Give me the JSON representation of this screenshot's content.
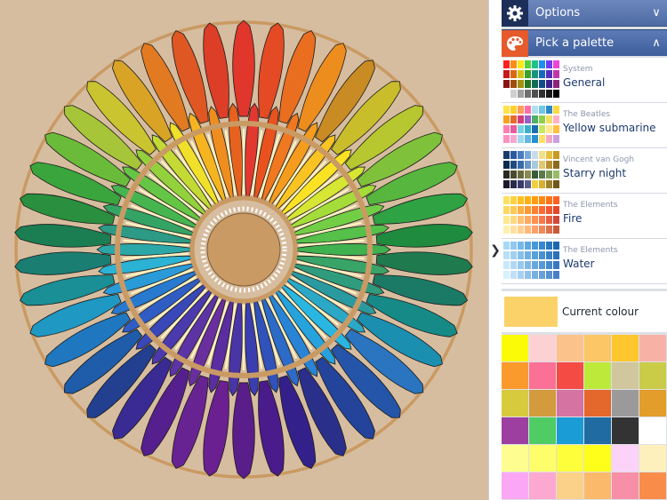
{
  "sidebar": {
    "options_label": "Options",
    "palette_label": "Pick a palette",
    "palettes": [
      {
        "category": "System",
        "name": "General",
        "swatches": [
          "#ff1f1f",
          "#ff8c1a",
          "#ffe817",
          "#55d13a",
          "#1fbf8e",
          "#1e8ff0",
          "#6a3df0",
          "#ee45d9",
          "#c51a1a",
          "#d96a12",
          "#d6c214",
          "#3aa12a",
          "#18957a",
          "#1769bd",
          "#532fbd",
          "#c036a9",
          "#8a1414",
          "#a04e0f",
          "#a1910f",
          "#2a7520",
          "#116b57",
          "#104c8a",
          "#3c228a",
          "#8a277a",
          "#ffffff",
          "#d0d0d0",
          "#a0a0a0",
          "#707070",
          "#505050",
          "#303030",
          "#181818",
          "#000000"
        ]
      },
      {
        "category": "The Beatles",
        "name": "Yellow submarine",
        "swatches": [
          "#ffe24a",
          "#ffd02a",
          "#ff9e5a",
          "#ff6fa8",
          "#b0e0f0",
          "#6fc7e8",
          "#2e89c8",
          "#ffd93d",
          "#f7a21c",
          "#e86a2a",
          "#d23d7a",
          "#9a5fc8",
          "#4fb06a",
          "#8fd04a",
          "#f0e060",
          "#ffb0c8",
          "#ff80b0",
          "#e85aa0",
          "#7ad0e0",
          "#3ab0d0",
          "#1a70b0",
          "#c8e860",
          "#ffe890",
          "#ffc040",
          "#ff90c0",
          "#f6a8d0",
          "#a0d8f0",
          "#60b8e8",
          "#2890d0",
          "#ffe060",
          "#f0a8c8",
          "#c8a0e0"
        ]
      },
      {
        "category": "Vincent van Gogh",
        "name": "Starry night",
        "swatches": [
          "#1a3a6e",
          "#2a5a9e",
          "#4a7ac0",
          "#7aa8d8",
          "#c8dcec",
          "#f0e08a",
          "#e8c040",
          "#c89a20",
          "#0e2a50",
          "#1e4a80",
          "#3a6aa8",
          "#6a98c8",
          "#a8c8e0",
          "#e0c870",
          "#b89030",
          "#8a6a20",
          "#2a2a20",
          "#4a4a30",
          "#6a6a40",
          "#8a8a50",
          "#3a5a3a",
          "#5a7a4a",
          "#7a9a5a",
          "#9aba6a",
          "#1a1a2a",
          "#2a2a4a",
          "#3a3a6a",
          "#5a5a8a",
          "#f0d040",
          "#d8b030",
          "#a08028",
          "#705818"
        ]
      },
      {
        "category": "The Elements",
        "name": "Fire",
        "swatches": [
          "#ffe060",
          "#ffd040",
          "#ffc020",
          "#ffb010",
          "#ff9c10",
          "#ff8810",
          "#ff7418",
          "#ff6020",
          "#ffd860",
          "#ffc850",
          "#ffb040",
          "#ff9830",
          "#ff8030",
          "#ff6a30",
          "#f05a30",
          "#e04a28",
          "#ffe890",
          "#ffd880",
          "#ffc070",
          "#ffa860",
          "#ff9050",
          "#f87848",
          "#e86040",
          "#d04838",
          "#fff0b0",
          "#ffe0a0",
          "#ffd090",
          "#ffb878",
          "#ffa068",
          "#f08858",
          "#e07048",
          "#c85838"
        ]
      },
      {
        "category": "The Elements",
        "name": "Water",
        "swatches": [
          "#a8d8f8",
          "#90c8f0",
          "#78b8e8",
          "#60a8e0",
          "#4898d8",
          "#3888d0",
          "#2878c0",
          "#1868b0",
          "#b8e0f8",
          "#a0d0f0",
          "#88c0e8",
          "#70b0e0",
          "#58a0d8",
          "#4890d0",
          "#3880c8",
          "#2870b8",
          "#c8e8fc",
          "#b0d8f4",
          "#98c8ec",
          "#80b8e4",
          "#68a8dc",
          "#5898d4",
          "#4888cc",
          "#3878c0",
          "#d8f0ff",
          "#c0e0f8",
          "#a8d0f0",
          "#90c0e8",
          "#78b0e0",
          "#68a0d8",
          "#5890d0",
          "#4880c8"
        ]
      }
    ],
    "current_colour_label": "Current colour",
    "current_colour": "#fbd26a",
    "swatch_grid": [
      [
        "#fbfb08",
        "#fdd1d3",
        "#fcc28b",
        "#fcc565",
        "#fdc72d",
        "#f7b2a5"
      ],
      [
        "#fb9a2c",
        "#fb7196",
        "#f54b45",
        "#bde93a",
        "#d0c79f",
        "#c9cb49"
      ],
      [
        "#d7ca3d",
        "#d39b3d",
        "#d573a3",
        "#e4672b",
        "#9a9a9a",
        "#e39d2b"
      ],
      [
        "#9c3fa1",
        "#4fcc64",
        "#1a9cd7",
        "#1f6ba2",
        "#333333",
        "#ffffff"
      ],
      [
        "#fefe90",
        "#fefe6a",
        "#fefe3a",
        "#fefe1a",
        "#fbd3f9",
        "#fef0bc"
      ],
      [
        "#fca7f3",
        "#fca8d0",
        "#fbd088",
        "#fbb96c",
        "#f78fa8",
        "#fa8c4a"
      ]
    ]
  },
  "artwork": {
    "background": "#d7bd9f",
    "ring_color": "#c99a63",
    "outer_feather_colors": [
      "#e0362b",
      "#e44a23",
      "#ea6e1f",
      "#ed8d1e",
      "#c98b23",
      "#c9bd2b",
      "#b6c72f",
      "#7fc13a",
      "#56b63e",
      "#2fa243",
      "#1f8b3e",
      "#1f7b4e",
      "#1b7a65",
      "#158a87",
      "#1b8faf",
      "#2a74c0",
      "#2555a8",
      "#24439a",
      "#2a2f8a",
      "#34208a",
      "#4a1b8a",
      "#5a1e8a",
      "#6a2090",
      "#682393",
      "#561f8e",
      "#3a2a93",
      "#22408f",
      "#1f5ca9",
      "#1f78bf",
      "#1f98c4",
      "#1a8f95",
      "#1a7e72",
      "#1b7e52",
      "#2a8f3e",
      "#3aa53c",
      "#6bbb3a",
      "#a6c538",
      "#c9c42f",
      "#d9a326",
      "#e27a22",
      "#df5722",
      "#dc3e27"
    ],
    "inner_feather_colors": [
      "#e3382f",
      "#e9521f",
      "#f07820",
      "#f59c1d",
      "#f8c323",
      "#fbe324",
      "#d6e632",
      "#a4dc39",
      "#72cf45",
      "#55c04a",
      "#3fb14f",
      "#39a467",
      "#2f9c7d",
      "#2b9aa0",
      "#2ba8c5",
      "#29b6e0",
      "#26a2dd",
      "#2984d5",
      "#2c6bc8",
      "#3052ba",
      "#3a3eae",
      "#4a35a7",
      "#5a2da0",
      "#6a2f9f",
      "#5d34a6",
      "#4b3aae",
      "#3a47b8",
      "#2f5dc4",
      "#287ad0",
      "#2a9bd8",
      "#2bb2d4",
      "#2ba7a8",
      "#2c9a85",
      "#34a464",
      "#46b550",
      "#65c544",
      "#93d13c",
      "#c3da34",
      "#f1e02a",
      "#f6b421",
      "#f08d1f",
      "#e8621f"
    ]
  }
}
